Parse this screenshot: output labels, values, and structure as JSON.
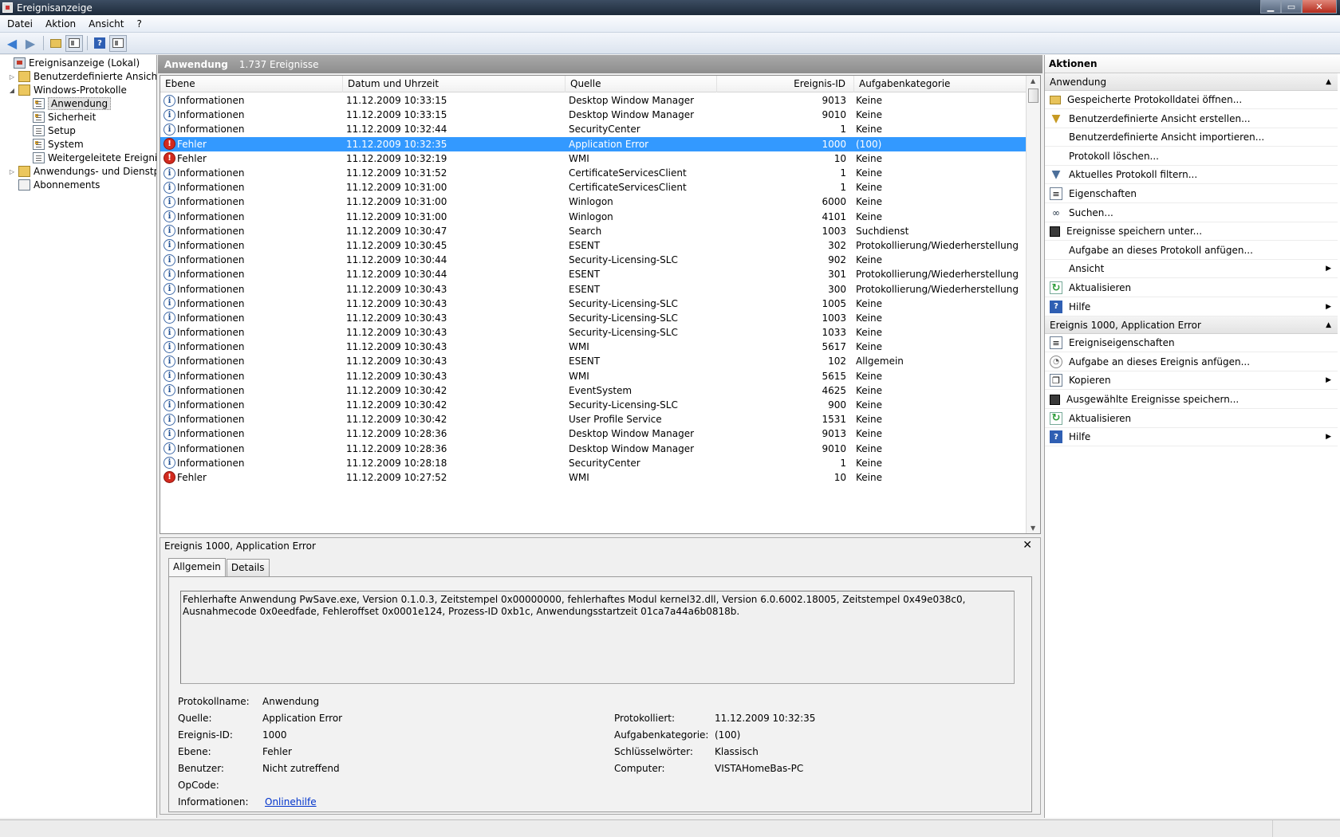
{
  "window": {
    "title": "Ereignisanzeige"
  },
  "menu": [
    "Datei",
    "Aktion",
    "Ansicht",
    "?"
  ],
  "tree": [
    {
      "label": "Ereignisanzeige (Lokal)",
      "icon": "computer-icon",
      "level": 0,
      "expander": ""
    },
    {
      "label": "Benutzerdefinierte Ansichten",
      "icon": "folder-icon",
      "level": 1,
      "expander": "▷"
    },
    {
      "label": "Windows-Protokolle",
      "icon": "folder-icon",
      "level": 1,
      "expander": "◢"
    },
    {
      "label": "Anwendung",
      "icon": "log-icon",
      "level": 2,
      "expander": "",
      "selected": true
    },
    {
      "label": "Sicherheit",
      "icon": "log-icon",
      "level": 2,
      "expander": ""
    },
    {
      "label": "Setup",
      "icon": "log-icon",
      "level": 2,
      "expander": ""
    },
    {
      "label": "System",
      "icon": "log-icon",
      "level": 2,
      "expander": ""
    },
    {
      "label": "Weitergeleitete Ereignisse",
      "icon": "log-icon",
      "level": 2,
      "expander": ""
    },
    {
      "label": "Anwendungs- und Dienstprotokolle",
      "icon": "folder-icon",
      "level": 1,
      "expander": "▷"
    },
    {
      "label": "Abonnements",
      "icon": "subscription-icon",
      "level": 1,
      "expander": ""
    }
  ],
  "list": {
    "title": "Anwendung",
    "count": "1.737 Ereignisse",
    "columns": [
      "Ebene",
      "Datum und Uhrzeit",
      "Quelle",
      "Ereignis-ID",
      "Aufgabenkategorie"
    ],
    "rows": [
      {
        "level": "Informationen",
        "date": "11.12.2009 10:33:15",
        "source": "Desktop Window Manager",
        "id": "9013",
        "category": "Keine"
      },
      {
        "level": "Informationen",
        "date": "11.12.2009 10:33:15",
        "source": "Desktop Window Manager",
        "id": "9010",
        "category": "Keine"
      },
      {
        "level": "Informationen",
        "date": "11.12.2009 10:32:44",
        "source": "SecurityCenter",
        "id": "1",
        "category": "Keine"
      },
      {
        "level": "Fehler",
        "date": "11.12.2009 10:32:35",
        "source": "Application Error",
        "id": "1000",
        "category": "(100)",
        "selected": true
      },
      {
        "level": "Fehler",
        "date": "11.12.2009 10:32:19",
        "source": "WMI",
        "id": "10",
        "category": "Keine"
      },
      {
        "level": "Informationen",
        "date": "11.12.2009 10:31:52",
        "source": "CertificateServicesClient",
        "id": "1",
        "category": "Keine"
      },
      {
        "level": "Informationen",
        "date": "11.12.2009 10:31:00",
        "source": "CertificateServicesClient",
        "id": "1",
        "category": "Keine"
      },
      {
        "level": "Informationen",
        "date": "11.12.2009 10:31:00",
        "source": "Winlogon",
        "id": "6000",
        "category": "Keine"
      },
      {
        "level": "Informationen",
        "date": "11.12.2009 10:31:00",
        "source": "Winlogon",
        "id": "4101",
        "category": "Keine"
      },
      {
        "level": "Informationen",
        "date": "11.12.2009 10:30:47",
        "source": "Search",
        "id": "1003",
        "category": "Suchdienst"
      },
      {
        "level": "Informationen",
        "date": "11.12.2009 10:30:45",
        "source": "ESENT",
        "id": "302",
        "category": "Protokollierung/Wiederherstellung"
      },
      {
        "level": "Informationen",
        "date": "11.12.2009 10:30:44",
        "source": "Security-Licensing-SLC",
        "id": "902",
        "category": "Keine"
      },
      {
        "level": "Informationen",
        "date": "11.12.2009 10:30:44",
        "source": "ESENT",
        "id": "301",
        "category": "Protokollierung/Wiederherstellung"
      },
      {
        "level": "Informationen",
        "date": "11.12.2009 10:30:43",
        "source": "ESENT",
        "id": "300",
        "category": "Protokollierung/Wiederherstellung"
      },
      {
        "level": "Informationen",
        "date": "11.12.2009 10:30:43",
        "source": "Security-Licensing-SLC",
        "id": "1005",
        "category": "Keine"
      },
      {
        "level": "Informationen",
        "date": "11.12.2009 10:30:43",
        "source": "Security-Licensing-SLC",
        "id": "1003",
        "category": "Keine"
      },
      {
        "level": "Informationen",
        "date": "11.12.2009 10:30:43",
        "source": "Security-Licensing-SLC",
        "id": "1033",
        "category": "Keine"
      },
      {
        "level": "Informationen",
        "date": "11.12.2009 10:30:43",
        "source": "WMI",
        "id": "5617",
        "category": "Keine"
      },
      {
        "level": "Informationen",
        "date": "11.12.2009 10:30:43",
        "source": "ESENT",
        "id": "102",
        "category": "Allgemein"
      },
      {
        "level": "Informationen",
        "date": "11.12.2009 10:30:43",
        "source": "WMI",
        "id": "5615",
        "category": "Keine"
      },
      {
        "level": "Informationen",
        "date": "11.12.2009 10:30:42",
        "source": "EventSystem",
        "id": "4625",
        "category": "Keine"
      },
      {
        "level": "Informationen",
        "date": "11.12.2009 10:30:42",
        "source": "Security-Licensing-SLC",
        "id": "900",
        "category": "Keine"
      },
      {
        "level": "Informationen",
        "date": "11.12.2009 10:30:42",
        "source": "User Profile Service",
        "id": "1531",
        "category": "Keine"
      },
      {
        "level": "Informationen",
        "date": "11.12.2009 10:28:36",
        "source": "Desktop Window Manager",
        "id": "9013",
        "category": "Keine"
      },
      {
        "level": "Informationen",
        "date": "11.12.2009 10:28:36",
        "source": "Desktop Window Manager",
        "id": "9010",
        "category": "Keine"
      },
      {
        "level": "Informationen",
        "date": "11.12.2009 10:28:18",
        "source": "SecurityCenter",
        "id": "1",
        "category": "Keine"
      },
      {
        "level": "Fehler",
        "date": "11.12.2009 10:27:52",
        "source": "WMI",
        "id": "10",
        "category": "Keine"
      }
    ]
  },
  "detail": {
    "title": "Ereignis 1000, Application Error",
    "tabs": [
      "Allgemein",
      "Details"
    ],
    "description": "Fehlerhafte Anwendung PwSave.exe, Version 0.1.0.3, Zeitstempel 0x00000000, fehlerhaftes Modul kernel32.dll, Version 6.0.6002.18005, Zeitstempel 0x49e038c0, Ausnahmecode 0x0eedfade, Fehleroffset 0x0001e124, Prozess-ID 0xb1c, Anwendungsstartzeit 01ca7a44a6b0818b.",
    "left_props": [
      {
        "label": "Protokollname:",
        "value": "Anwendung"
      },
      {
        "label": "Quelle:",
        "value": "Application Error"
      },
      {
        "label": "Ereignis-ID:",
        "value": "1000"
      },
      {
        "label": "Ebene:",
        "value": "Fehler"
      },
      {
        "label": "Benutzer:",
        "value": "Nicht zutreffend"
      },
      {
        "label": "OpCode:",
        "value": ""
      },
      {
        "label": "Informationen:",
        "value": "Onlinehilfe",
        "link": true
      }
    ],
    "right_props": [
      {
        "label": "Protokolliert:",
        "value": "11.12.2009 10:32:35"
      },
      {
        "label": "Aufgabenkategorie:",
        "value": "(100)"
      },
      {
        "label": "Schlüsselwörter:",
        "value": "Klassisch"
      },
      {
        "label": "Computer:",
        "value": "VISTAHomeBas-PC"
      }
    ]
  },
  "actions": {
    "title": "Aktionen",
    "sections": [
      {
        "title": "Anwendung",
        "items": [
          {
            "label": "Gespeicherte Protokolldatei öffnen...",
            "icon": "open-folder-icon"
          },
          {
            "label": "Benutzerdefinierte Ansicht erstellen...",
            "icon": "create-filter-icon"
          },
          {
            "label": "Benutzerdefinierte Ansicht importieren...",
            "icon": ""
          },
          {
            "label": "Protokoll löschen...",
            "icon": ""
          },
          {
            "label": "Aktuelles Protokoll filtern...",
            "icon": "filter-icon"
          },
          {
            "label": "Eigenschaften",
            "icon": "properties-icon"
          },
          {
            "label": "Suchen...",
            "icon": "binoculars-icon"
          },
          {
            "label": "Ereignisse speichern unter...",
            "icon": "save-icon"
          },
          {
            "label": "Aufgabe an dieses Protokoll anfügen...",
            "icon": ""
          },
          {
            "label": "Ansicht",
            "icon": "",
            "submenu": true
          },
          {
            "label": "Aktualisieren",
            "icon": "refresh-icon"
          },
          {
            "label": "Hilfe",
            "icon": "help-icon",
            "submenu": true
          }
        ]
      },
      {
        "title": "Ereignis 1000, Application Error",
        "items": [
          {
            "label": "Ereigniseigenschaften",
            "icon": "properties-icon"
          },
          {
            "label": "Aufgabe an dieses Ereignis anfügen...",
            "icon": "task-icon"
          },
          {
            "label": "Kopieren",
            "icon": "copy-icon",
            "submenu": true
          },
          {
            "label": "Ausgewählte Ereignisse speichern...",
            "icon": "save-icon"
          },
          {
            "label": "Aktualisieren",
            "icon": "refresh-icon"
          },
          {
            "label": "Hilfe",
            "icon": "help-icon",
            "submenu": true
          }
        ]
      }
    ]
  }
}
